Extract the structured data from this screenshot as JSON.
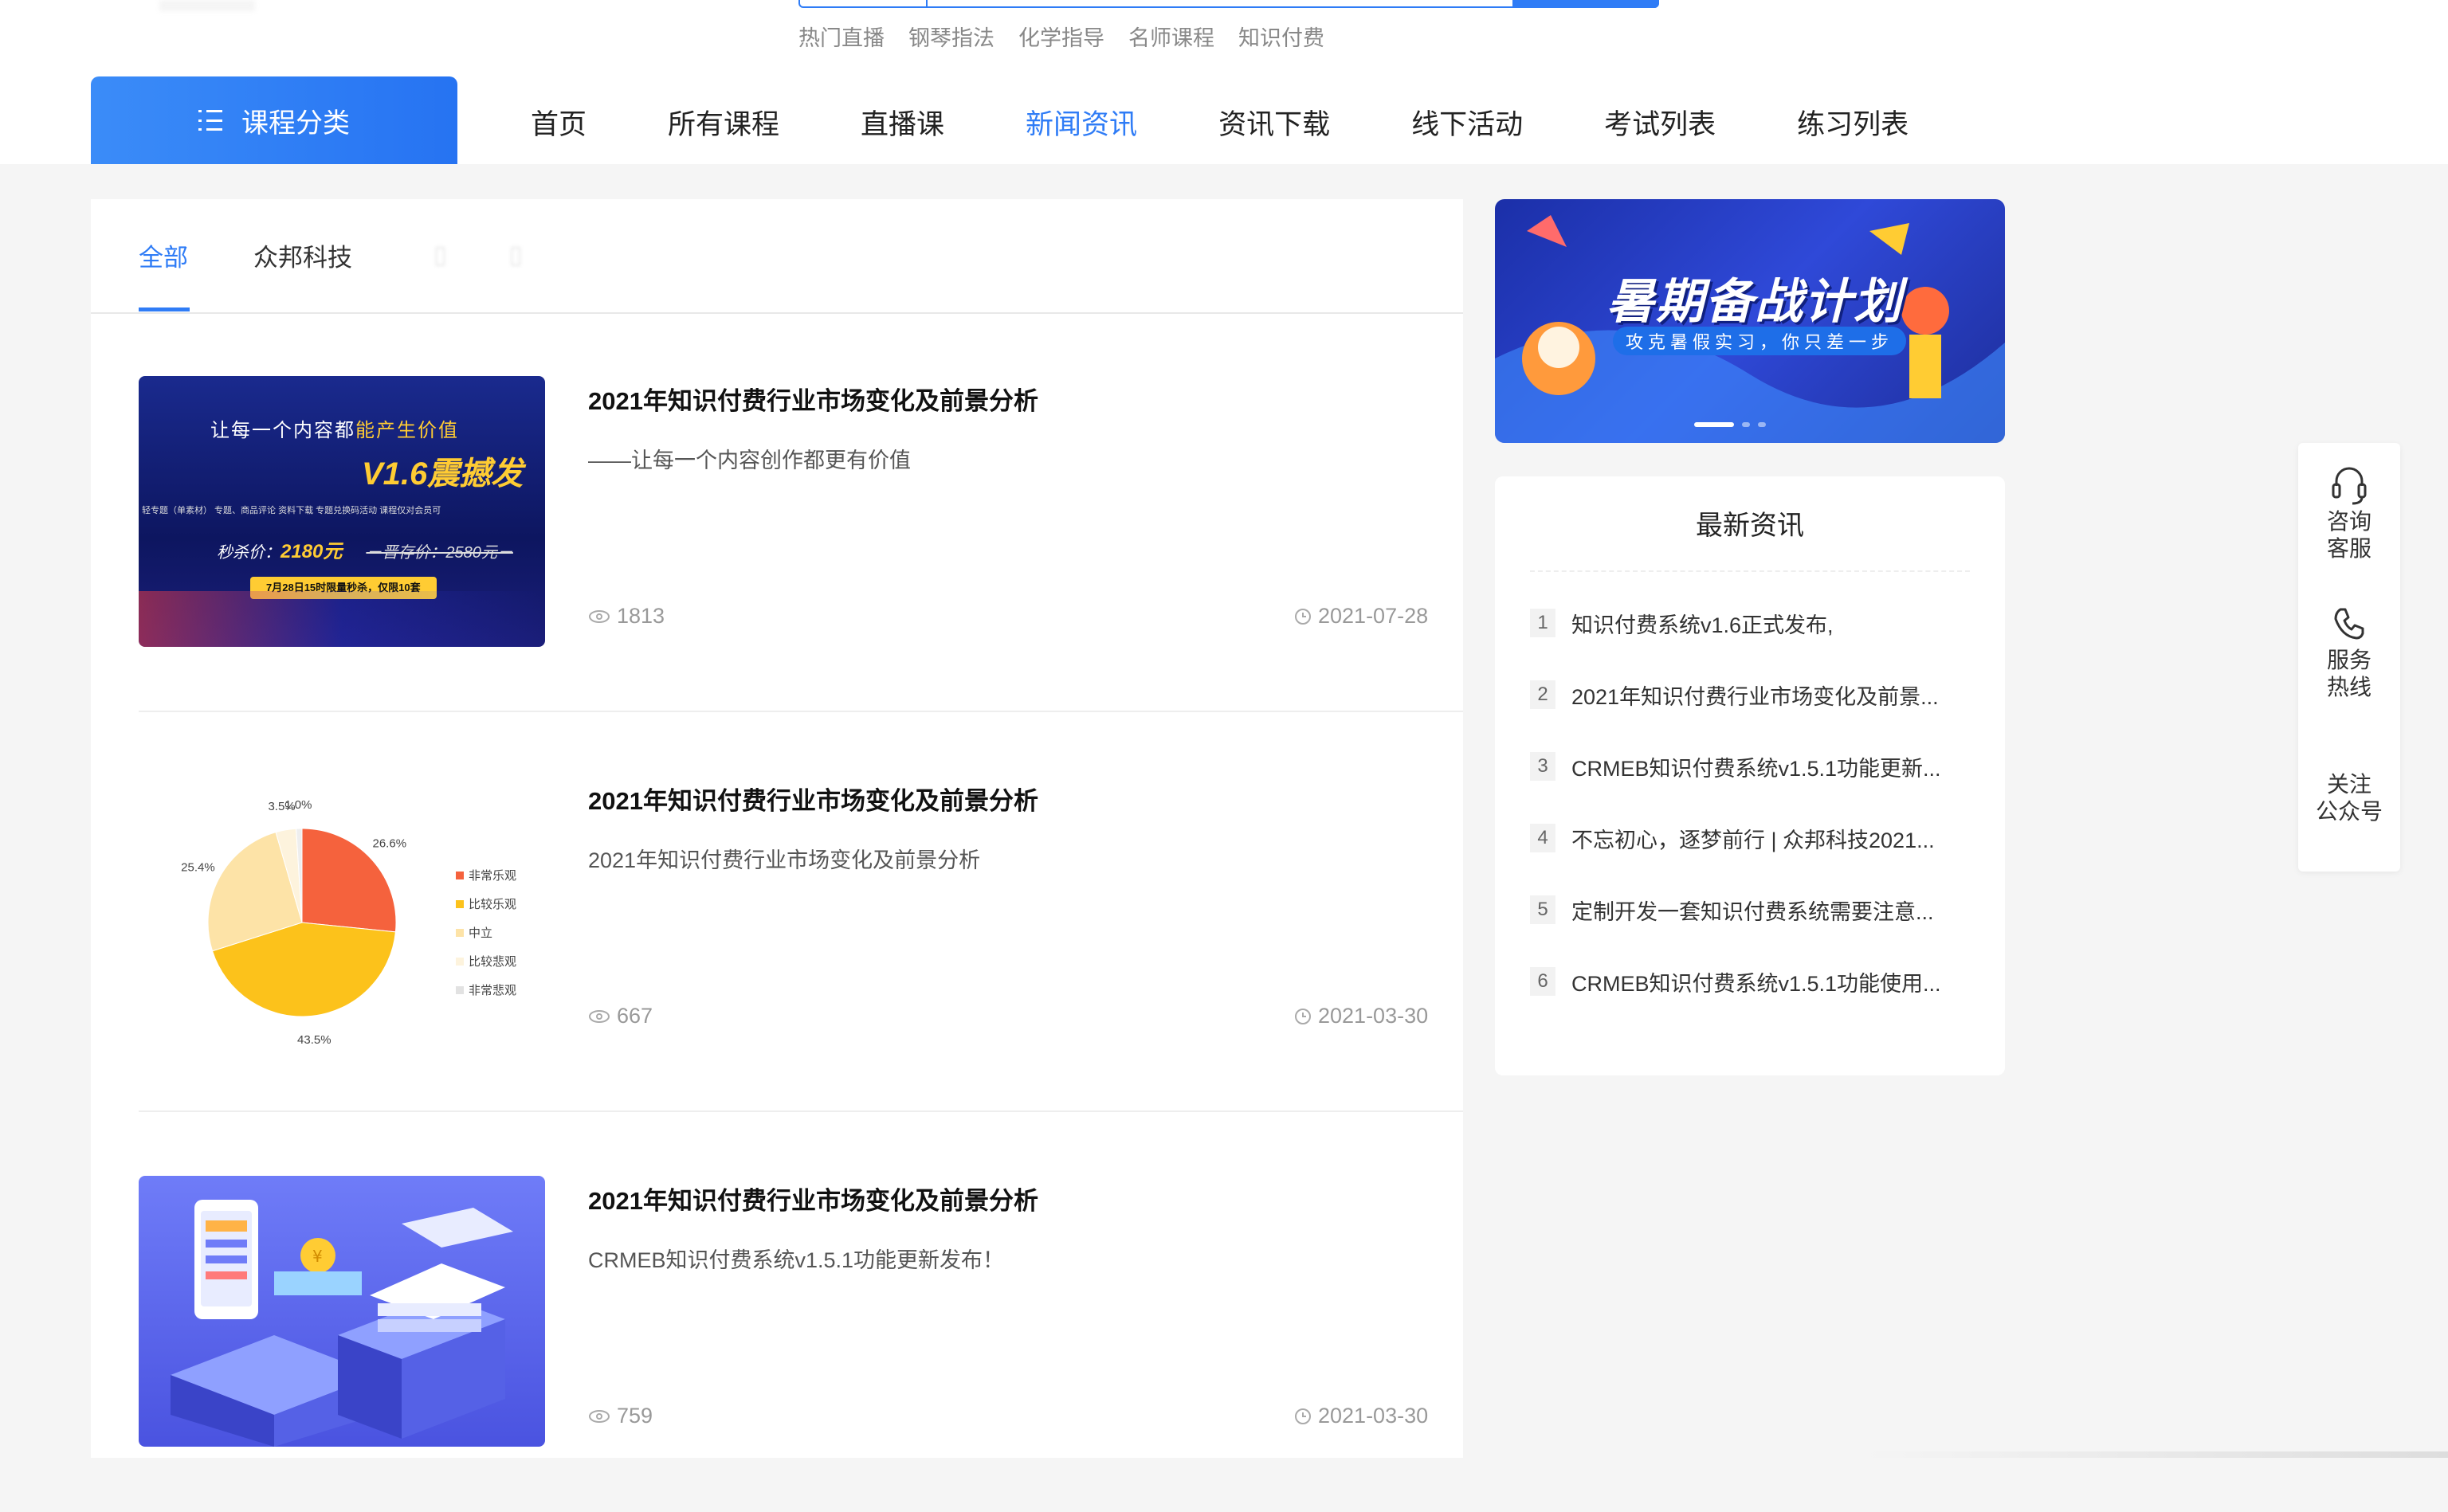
{
  "header": {
    "hot_words": [
      "热门直播",
      "钢琴指法",
      "化学指导",
      "名师课程",
      "知识付费"
    ],
    "category_label": "课程分类",
    "nav": [
      {
        "label": "首页",
        "active": false
      },
      {
        "label": "所有课程",
        "active": false
      },
      {
        "label": "直播课",
        "active": false
      },
      {
        "label": "新闻资讯",
        "active": true
      },
      {
        "label": "资讯下载",
        "active": false
      },
      {
        "label": "线下活动",
        "active": false
      },
      {
        "label": "考试列表",
        "active": false
      },
      {
        "label": "练习列表",
        "active": false
      }
    ]
  },
  "tabs": [
    {
      "label": "全部",
      "active": true
    },
    {
      "label": "众邦科技",
      "active": false
    }
  ],
  "articles": [
    {
      "title": "2021年知识付费行业市场变化及前景分析",
      "desc": "——让每一个内容创作都更有价值",
      "views": "1813",
      "date": "2021-07-28",
      "thumb": {
        "line1_a": "让每一个内容都",
        "line1_b": "能产生价值",
        "line2": "V1.6震撼发",
        "line3": "轻专题（单素材）  专题、商品评论  资料下载  专题兑换码活动  课程仅对会员可",
        "price_label": "秒杀价：",
        "price": "2180元",
        "orig": "－晋存价：2580元－",
        "tag": "7月28日15时限量秒杀，仅限10套"
      }
    },
    {
      "title": "2021年知识付费行业市场变化及前景分析",
      "desc": "2021年知识付费行业市场变化及前景分析",
      "views": "667",
      "date": "2021-03-30"
    },
    {
      "title": "2021年知识付费行业市场变化及前景分析",
      "desc": "CRMEB知识付费系统v1.5.1功能更新发布！",
      "views": "759",
      "date": "2021-03-30"
    }
  ],
  "chart_data": {
    "type": "pie",
    "categories": [
      "非常乐观",
      "比较乐观",
      "中立",
      "比较悲观",
      "非常悲观"
    ],
    "values": [
      26.6,
      43.5,
      25.4,
      3.5,
      1.0
    ],
    "labels": [
      "26.6%",
      "43.5%",
      "25.4%",
      "3.5%",
      "1.0%"
    ],
    "colors": [
      "#f5623d",
      "#fcc21b",
      "#fde3a7",
      "#fdf3dd",
      "#eeeeee"
    ],
    "legend": "right"
  },
  "banner": {
    "title": "暑期备战计划",
    "subtitle": "攻克暑假实习，你只差一步"
  },
  "latest": {
    "heading": "最新资讯",
    "items": [
      {
        "num": "1",
        "text": "知识付费系统v1.6正式发布,"
      },
      {
        "num": "2",
        "text": "2021年知识付费行业市场变化及前景..."
      },
      {
        "num": "3",
        "text": "CRMEB知识付费系统v1.5.1功能更新..."
      },
      {
        "num": "4",
        "text": "不忘初心，逐梦前行 | 众邦科技2021..."
      },
      {
        "num": "5",
        "text": "定制开发一套知识付费系统需要注意..."
      },
      {
        "num": "6",
        "text": "CRMEB知识付费系统v1.5.1功能使用..."
      }
    ]
  },
  "float": {
    "consult": [
      "咨询",
      "客服"
    ],
    "hotline": [
      "服务",
      "热线"
    ],
    "follow": [
      "关注",
      "公众号"
    ]
  },
  "colors": {
    "accent": "#2f7cf6"
  }
}
